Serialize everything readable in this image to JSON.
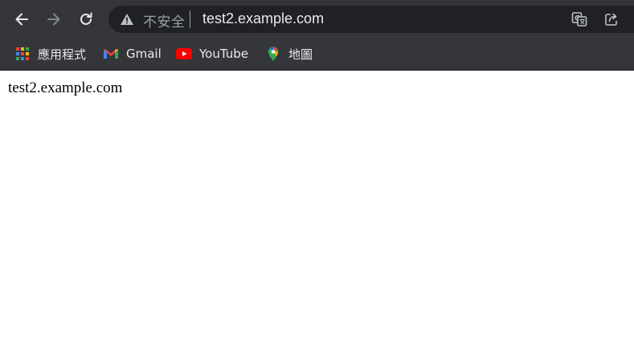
{
  "browser": {
    "security_label": "不安全",
    "address": "test2.example.com"
  },
  "bookmarks": [
    {
      "label": "應用程式",
      "icon": "apps-grid-icon"
    },
    {
      "label": "Gmail",
      "icon": "gmail-icon"
    },
    {
      "label": "YouTube",
      "icon": "youtube-icon"
    },
    {
      "label": "地圖",
      "icon": "maps-pin-icon"
    }
  ],
  "page": {
    "body_text": "test2.example.com"
  },
  "colors": {
    "toolbar": "#35363a",
    "omnibox": "#202124",
    "text_light": "#e8eaed",
    "text_dim": "#9aa0a6"
  }
}
